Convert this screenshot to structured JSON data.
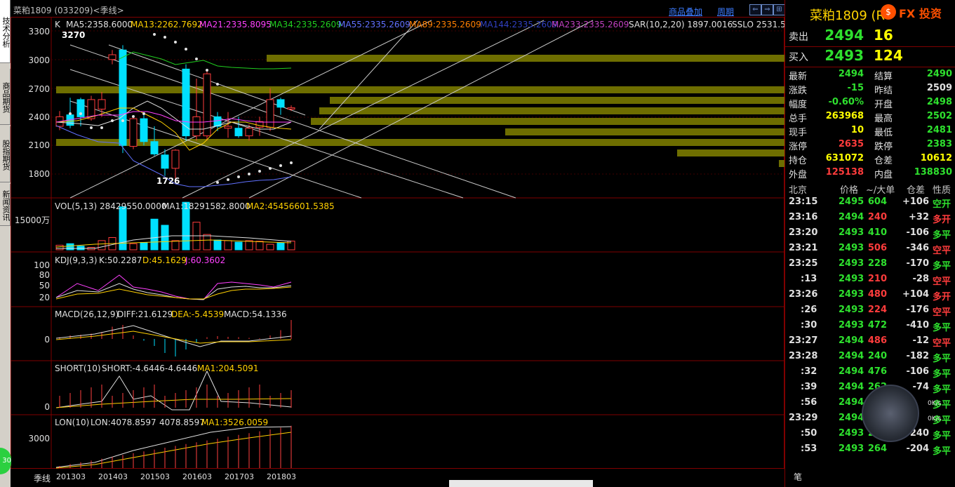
{
  "left_tabs": [
    "技术分析",
    "商品期货",
    "股指期货",
    "新闻资讯"
  ],
  "title": "菜粕1809 (033209)<季线>",
  "top_links": [
    "商品叠加",
    "周期"
  ],
  "main_indicator": {
    "k": "K",
    "ma5": "MA5:2358.6000",
    "ma13": "MA13:2262.7692",
    "ma21": "MA21:2335.8095",
    "ma34": "MA34:2335.2609",
    "ma55": "MA55:2335.2609",
    "ma89": "MA89:2335.2609",
    "ma144": "MA144:2335.2609",
    "ma233": "MA233:2335.2609",
    "sar": "SAR(10,2,20) 1897.0016",
    "sslo": "SSLO 2531.5"
  },
  "price_axis": [
    "3300",
    "3000",
    "2700",
    "2400",
    "2100",
    "1800"
  ],
  "high_label": "3270",
  "low_label": "1726",
  "vol": {
    "label": "VOL(5,13) 28429550.0000",
    "ma1": "MA1:18291582.8000",
    "ma2": "MA2:45456601.5385",
    "axis": "15000万"
  },
  "kdj": {
    "label": "KDJ(9,3,3)",
    "k": "K:50.2287",
    "d": "D:45.1629",
    "j": "J:60.3602",
    "axis": [
      "100",
      "80",
      "50",
      "20"
    ]
  },
  "macd": {
    "label": "MACD(26,12,9)",
    "diff": "DIFF:21.6129",
    "dea": "DEA:-5.4539",
    "macd": "MACD:54.1336",
    "axis": "0"
  },
  "short": {
    "label": "SHORT(10)",
    "val1": "SHORT:-4.6446",
    "val2": "-4.6446",
    "ma1": "MA1:204.5091",
    "axis": "0"
  },
  "lon": {
    "label": "LON(10)",
    "val1": "LON:4078.8597",
    "val2": "4078.8597",
    "ma1": "MA1:3526.0059",
    "axis": "3000"
  },
  "period_label": "季线",
  "x_ticks": [
    "201303",
    "201403",
    "201503",
    "201603",
    "201703",
    "201803"
  ],
  "quote": {
    "title": "菜粕1809 (R",
    "sell_label": "卖出",
    "sell_price": "2494",
    "sell_qty": "16",
    "buy_label": "买入",
    "buy_price": "2493",
    "buy_qty": "124",
    "rows": [
      {
        "l1": "最新",
        "v1": "2494",
        "c1": "green",
        "l2": "结算",
        "v2": "2490",
        "c2": "green"
      },
      {
        "l1": "涨跌",
        "v1": "-15",
        "c1": "green",
        "l2": "昨结",
        "v2": "2509",
        "c2": "white"
      },
      {
        "l1": "幅度",
        "v1": "-0.60%",
        "c1": "green",
        "l2": "开盘",
        "v2": "2498",
        "c2": "green"
      },
      {
        "l1": "总手",
        "v1": "263968",
        "c1": "yellow",
        "l2": "最高",
        "v2": "2502",
        "c2": "green"
      },
      {
        "l1": "现手",
        "v1": "10",
        "c1": "yellow",
        "l2": "最低",
        "v2": "2481",
        "c2": "green"
      },
      {
        "l1": "涨停",
        "v1": "2635",
        "c1": "red",
        "l2": "跌停",
        "v2": "2383",
        "c2": "green"
      },
      {
        "l1": "持仓",
        "v1": "631072",
        "c1": "yellow",
        "l2": "仓差",
        "v2": "10612",
        "c2": "yellow"
      },
      {
        "l1": "外盘",
        "v1": "125138",
        "c1": "red",
        "l2": "内盘",
        "v2": "138830",
        "c2": "green"
      }
    ],
    "ticks_header": [
      "北京",
      "价格",
      "~/大单",
      "仓差",
      "性质"
    ],
    "ticks": [
      {
        "t": "23:15",
        "p": "2495",
        "v": "604",
        "vc": "green",
        "d": "+106",
        "n": "空开",
        "nc": "green"
      },
      {
        "t": "23:16",
        "p": "2494",
        "v": "240",
        "vc": "red",
        "d": "+32",
        "n": "多开",
        "nc": "red"
      },
      {
        "t": "23:20",
        "p": "2493",
        "v": "410",
        "vc": "green",
        "d": "-106",
        "n": "多平",
        "nc": "green"
      },
      {
        "t": "23:21",
        "p": "2493",
        "v": "506",
        "vc": "red",
        "d": "-346",
        "n": "空平",
        "nc": "red"
      },
      {
        "t": "23:25",
        "p": "2493",
        "v": "228",
        "vc": "green",
        "d": "-170",
        "n": "多平",
        "nc": "green"
      },
      {
        "t": ":13",
        "p": "2493",
        "v": "210",
        "vc": "red",
        "d": "-28",
        "n": "空平",
        "nc": "red"
      },
      {
        "t": "23:26",
        "p": "2493",
        "v": "480",
        "vc": "red",
        "d": "+104",
        "n": "多开",
        "nc": "red"
      },
      {
        "t": ":26",
        "p": "2493",
        "v": "224",
        "vc": "red",
        "d": "-176",
        "n": "空平",
        "nc": "red"
      },
      {
        "t": ":30",
        "p": "2493",
        "v": "472",
        "vc": "green",
        "d": "-410",
        "n": "多平",
        "nc": "green"
      },
      {
        "t": "23:27",
        "p": "2494",
        "v": "486",
        "vc": "red",
        "d": "-12",
        "n": "空平",
        "nc": "red"
      },
      {
        "t": "23:28",
        "p": "2494",
        "v": "240",
        "vc": "green",
        "d": "-182",
        "n": "多平",
        "nc": "green"
      },
      {
        "t": ":32",
        "p": "2494",
        "v": "476",
        "vc": "green",
        "d": "-106",
        "n": "多平",
        "nc": "green"
      },
      {
        "t": ":39",
        "p": "2494",
        "v": "262",
        "vc": "green",
        "d": "-74",
        "n": "多平",
        "nc": "green"
      },
      {
        "t": ":56",
        "p": "2494",
        "v": "",
        "vc": "green",
        "d": "",
        "n": "多平",
        "nc": "green"
      },
      {
        "t": "23:29",
        "p": "2494",
        "v": "",
        "vc": "green",
        "d": "",
        "n": "多平",
        "nc": "green"
      },
      {
        "t": ":50",
        "p": "2493",
        "v": "280",
        "vc": "green",
        "d": "-240",
        "n": "多平",
        "nc": "green"
      },
      {
        "t": ":53",
        "p": "2493",
        "v": "264",
        "vc": "green",
        "d": "-204",
        "n": "多平",
        "nc": "green"
      }
    ],
    "bottom_tab": "笔"
  },
  "speed": {
    "up": "0K/s",
    "down": "0K/s"
  },
  "logo": "FX 投资",
  "side_number": "30",
  "chart_data": {
    "type": "candlestick",
    "x": [
      "201303",
      "201306",
      "201309",
      "201312",
      "201403",
      "201406",
      "201409",
      "201412",
      "201503",
      "201506",
      "201509",
      "201512",
      "201603",
      "201606",
      "201609",
      "201612",
      "201703",
      "201706",
      "201709",
      "201712",
      "201803",
      "201806",
      "201809"
    ],
    "open": [
      2300,
      2420,
      2580,
      2380,
      2480,
      3000,
      3100,
      2090,
      2380,
      2140,
      2000,
      1860,
      2900,
      2200,
      2200,
      2400,
      2280,
      2280,
      2200,
      2290,
      2290,
      2580,
      2480
    ],
    "close": [
      2400,
      2310,
      2400,
      2580,
      2580,
      3050,
      2100,
      2380,
      2140,
      2010,
      1860,
      2050,
      2200,
      2400,
      2850,
      2300,
      2300,
      2200,
      2280,
      2350,
      2580,
      2500,
      2494
    ],
    "high": [
      2460,
      2600,
      2600,
      2620,
      2660,
      3100,
      3150,
      2400,
      2420,
      2300,
      2060,
      2060,
      2950,
      2800,
      2900,
      2450,
      2450,
      2400,
      2320,
      2400,
      2700,
      2600,
      2520
    ],
    "low": [
      2260,
      2280,
      2300,
      2360,
      2400,
      2950,
      2020,
      2060,
      2100,
      1990,
      1780,
      1726,
      2150,
      2150,
      2150,
      2250,
      2180,
      2180,
      2150,
      2200,
      2250,
      2420,
      2460
    ],
    "ylim": [
      1650,
      3350
    ],
    "series_vol": [
      1500,
      2000,
      1200,
      800,
      3000,
      4000,
      14000,
      2000,
      2400,
      10000,
      8000,
      3000,
      15500,
      9000,
      5000,
      3200,
      3000,
      2500,
      3000,
      2800,
      1800,
      2300,
      2843
    ],
    "kdj_k": [
      60,
      70,
      50,
      40,
      55,
      75,
      60,
      40,
      30,
      22,
      20,
      20,
      60,
      65,
      70,
      55,
      55,
      50,
      48,
      45,
      50,
      52,
      50
    ],
    "macd": [
      5,
      10,
      12,
      15,
      20,
      35,
      40,
      10,
      -5,
      -20,
      -40,
      -50,
      -30,
      -10,
      5,
      8,
      6,
      5,
      3,
      2,
      10,
      25,
      54
    ]
  }
}
